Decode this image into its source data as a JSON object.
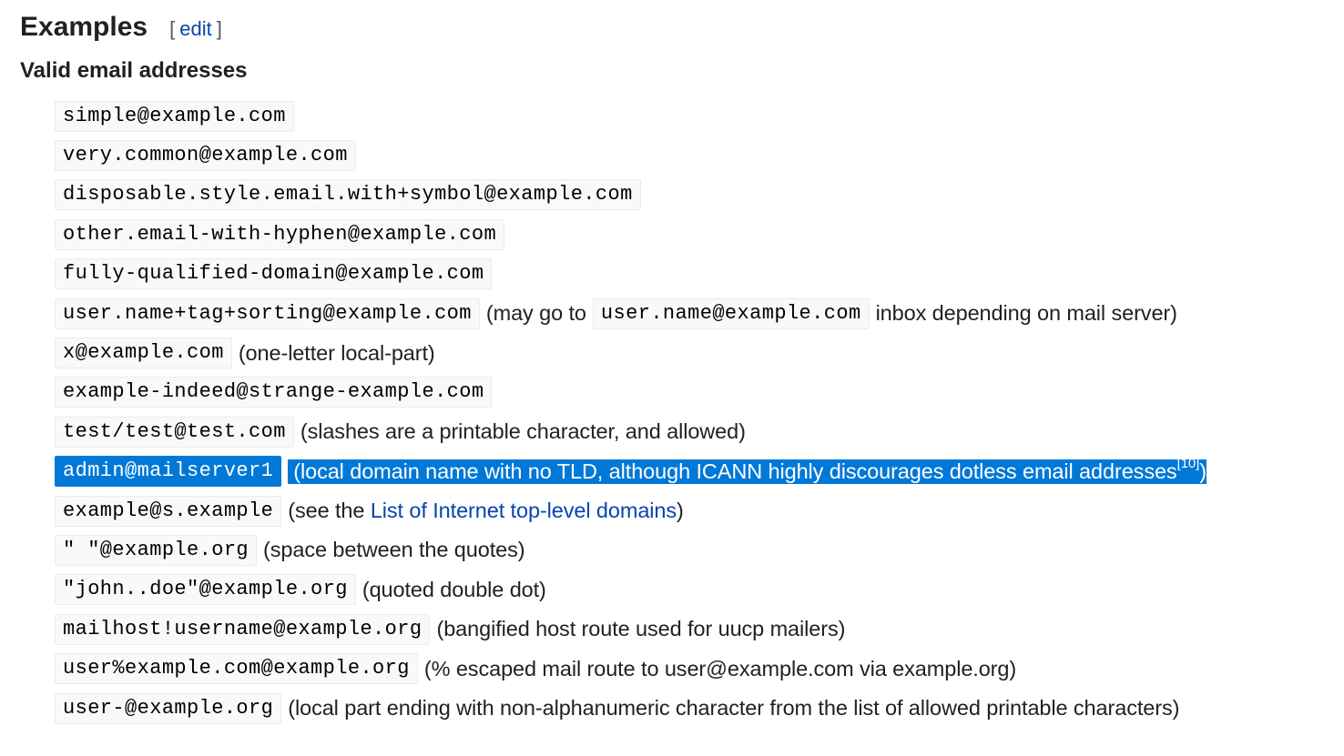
{
  "section": {
    "title": "Examples",
    "edit_open": "[",
    "edit_label": "edit",
    "edit_close": "]"
  },
  "subsection": {
    "title": "Valid email addresses"
  },
  "examples": [
    {
      "code": "simple@example.com"
    },
    {
      "code": "very.common@example.com"
    },
    {
      "code": "disposable.style.email.with+symbol@example.com"
    },
    {
      "code": "other.email-with-hyphen@example.com"
    },
    {
      "code": "fully-qualified-domain@example.com"
    },
    {
      "code": "user.name+tag+sorting@example.com",
      "note_pre": "(may go to",
      "code2": "user.name@example.com",
      "note_post": "inbox depending on mail server)"
    },
    {
      "code": "x@example.com",
      "note": "(one-letter local-part)"
    },
    {
      "code": "example-indeed@strange-example.com"
    },
    {
      "code": "test/test@test.com",
      "note": "(slashes are a printable character, and allowed)"
    },
    {
      "code": "admin@mailserver1",
      "note": "(local domain name with no TLD, although ICANN highly discourages dotless email addresses",
      "ref": "[10]",
      "note_end": ")"
    },
    {
      "code": "example@s.example",
      "note_pre": "(see the",
      "link": "List of Internet top-level domains",
      "note_end": ")"
    },
    {
      "code": "\" \"@example.org",
      "note": "(space between the quotes)"
    },
    {
      "code": "\"john..doe\"@example.org",
      "note": "(quoted double dot)"
    },
    {
      "code": "mailhost!username@example.org",
      "note": "(bangified host route used for uucp mailers)"
    },
    {
      "code": "user%example.com@example.org",
      "note": "(% escaped mail route to user@example.com via example.org)"
    },
    {
      "code": "user-@example.org",
      "note": "(local part ending with non-alphanumeric character from the list of allowed printable characters)"
    }
  ],
  "colors": {
    "link": "#0645ad",
    "selection": "#0078d7",
    "code_background": "#f8f9fa",
    "code_border": "#eaecf0"
  }
}
